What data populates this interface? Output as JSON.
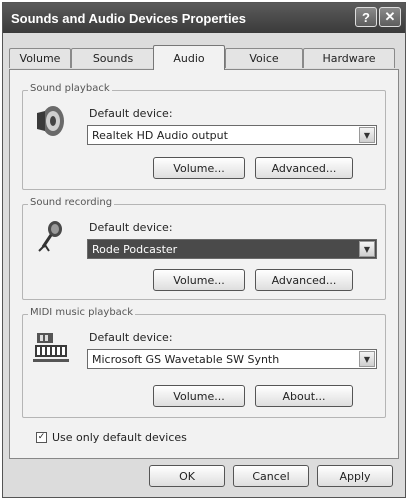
{
  "window": {
    "title": "Sounds and Audio Devices Properties",
    "help_label": "?",
    "close_label": "✕"
  },
  "tabs": [
    {
      "label": "Volume"
    },
    {
      "label": "Sounds"
    },
    {
      "label": "Audio"
    },
    {
      "label": "Voice"
    },
    {
      "label": "Hardware"
    }
  ],
  "playback": {
    "title": "Sound playback",
    "default_label": "Default device:",
    "device": "Realtek HD Audio output",
    "volume_label": "Volume...",
    "advanced_label": "Advanced..."
  },
  "recording": {
    "title": "Sound recording",
    "default_label": "Default device:",
    "device": "Rode Podcaster",
    "volume_label": "Volume...",
    "advanced_label": "Advanced..."
  },
  "midi": {
    "title": "MIDI music playback",
    "default_label": "Default device:",
    "device": "Microsoft GS Wavetable SW Synth",
    "volume_label": "Volume...",
    "about_label": "About..."
  },
  "use_default_only": {
    "label": "Use only default devices",
    "checked": true,
    "mark": "✓"
  },
  "footer": {
    "ok_label": "OK",
    "cancel_label": "Cancel",
    "apply_label": "Apply"
  },
  "icons": {
    "dropdown": "▼"
  }
}
